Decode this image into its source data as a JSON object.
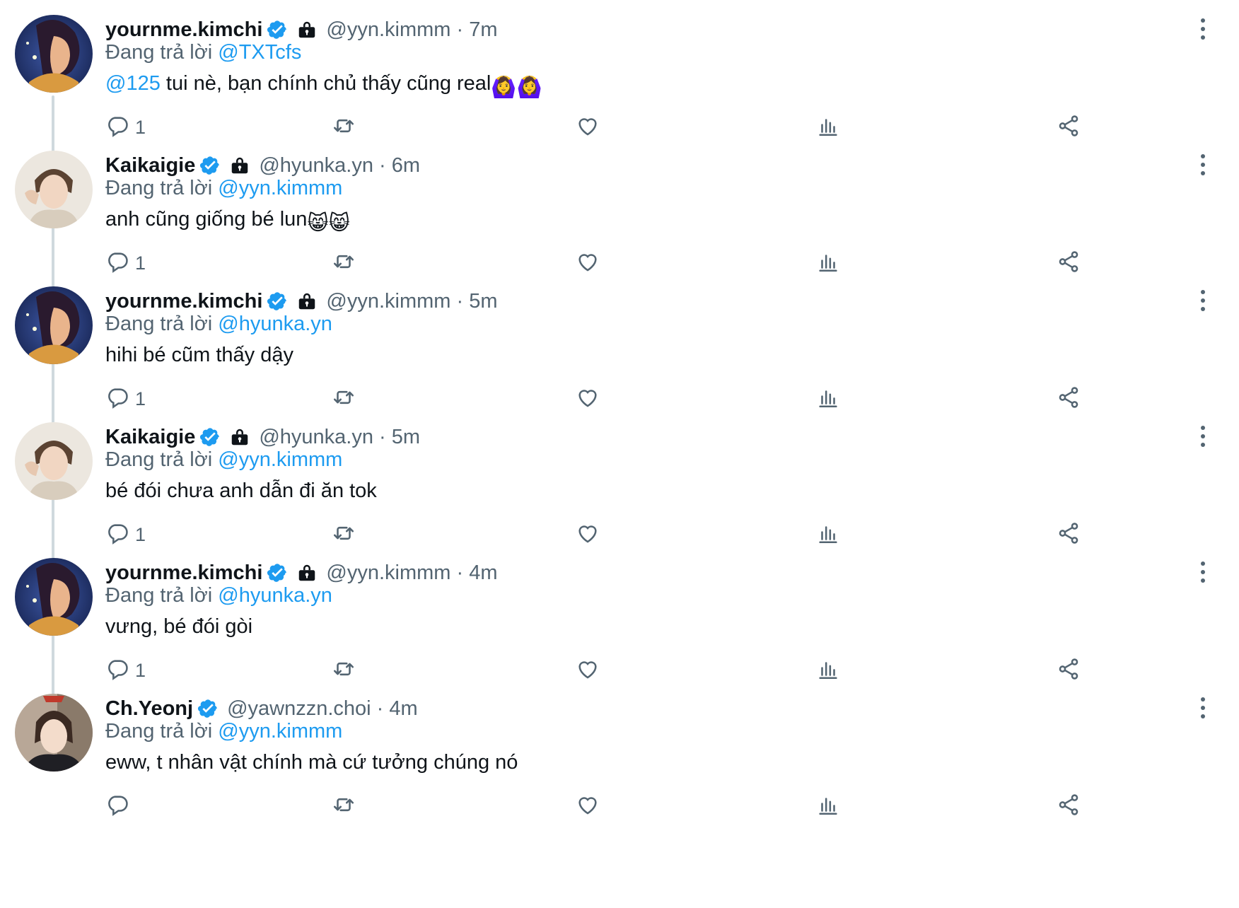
{
  "colors": {
    "link": "#1d9bf0",
    "secondary": "#536471",
    "text": "#0f1419",
    "verified": "#1d9bf0",
    "thread_line": "#cfd9de"
  },
  "replying_prefix": "Đang trả lời",
  "tweets": [
    {
      "name": "yournme.kimchi",
      "verified": true,
      "locked": true,
      "handle": "@yyn.kimmm · 7m",
      "replying_to": "@TXTcfs",
      "mention": "@125",
      "text": " tui nè, bạn chính chủ thấy cũng real",
      "emoji": "🙆‍♀️🙆‍♀️",
      "replies": "1",
      "avatar": "anime-girl-avatar"
    },
    {
      "name": "Kaikaigie",
      "verified": true,
      "locked": true,
      "handle": "@hyunka.yn · 6m",
      "replying_to": "@yyn.kimmm",
      "mention": "",
      "text": "anh cũng giống bé lun",
      "emoji": "😸😸",
      "replies": "1",
      "avatar": "boy-photo-avatar"
    },
    {
      "name": "yournme.kimchi",
      "verified": true,
      "locked": true,
      "handle": "@yyn.kimmm · 5m",
      "replying_to": "@hyunka.yn",
      "mention": "",
      "text": "hihi bé cũm thấy dậy",
      "emoji": "",
      "replies": "1",
      "avatar": "anime-girl-avatar"
    },
    {
      "name": "Kaikaigie",
      "verified": true,
      "locked": true,
      "handle": "@hyunka.yn · 5m",
      "replying_to": "@yyn.kimmm",
      "mention": "",
      "text": "bé đói chưa anh dẫn đi ăn tok",
      "emoji": "",
      "replies": "1",
      "avatar": "boy-photo-avatar"
    },
    {
      "name": "yournme.kimchi",
      "verified": true,
      "locked": true,
      "handle": "@yyn.kimmm · 4m",
      "replying_to": "@hyunka.yn",
      "mention": "",
      "text": "vưng, bé đói gòi",
      "emoji": "",
      "replies": "1",
      "avatar": "anime-girl-avatar"
    },
    {
      "name": "Ch.Yeonj",
      "verified": true,
      "locked": false,
      "handle": "@yawnzzn.choi · 4m",
      "replying_to": "@yyn.kimmm",
      "mention": "",
      "text": "eww, t nhân vật chính mà cứ tưởng chúng nó",
      "emoji": "",
      "replies": "",
      "avatar": "yeonjun-photo-avatar"
    }
  ]
}
